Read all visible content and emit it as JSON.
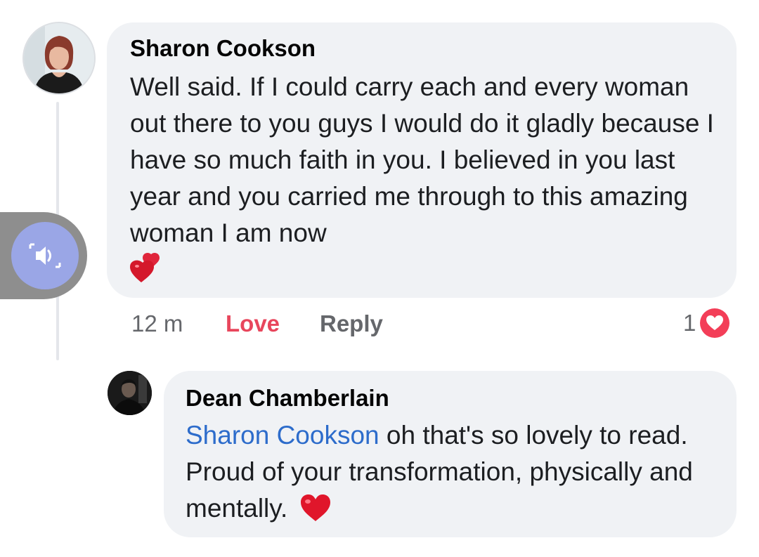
{
  "comment": {
    "author": "Sharon Cookson",
    "text": "Well said. If I could carry each and every woman out there to you guys I would do it gladly because I have so much faith in you. I believed in you last year and you carried me through to this amazing woman I am now",
    "emoji": "two-hearts-emoji",
    "time": "12 m",
    "love_label": "Love",
    "reply_label": "Reply",
    "reaction_count": "1",
    "reaction_icon": "love-reaction-icon"
  },
  "reply": {
    "author": "Dean Chamberlain",
    "mention": "Sharon Cookson",
    "text": " oh that's so lovely to read. Proud of your transformation, physically and mentally.",
    "emoji": "red-heart-emoji"
  },
  "overlay": {
    "icon": "speaker-icon"
  },
  "colors": {
    "bubble": "#f0f2f5",
    "love": "#e8465c",
    "mention": "#2d6ccb",
    "muted": "#65676b",
    "reaction": "#f33e58",
    "overlay_button": "#9aa6e6"
  }
}
